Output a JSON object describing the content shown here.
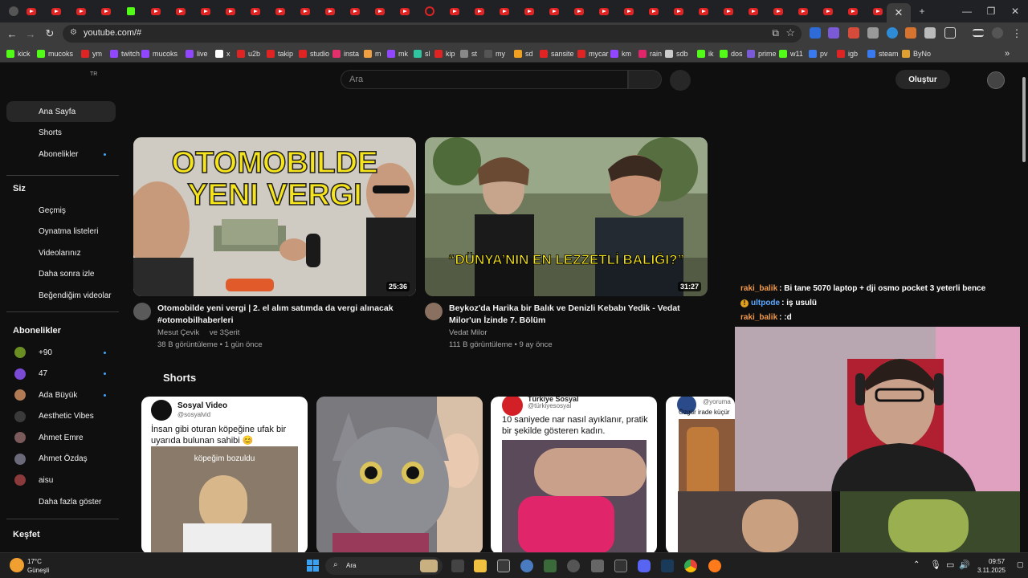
{
  "browser": {
    "active_tab_close": "✕",
    "new_tab": "+",
    "url": "youtube.com/#",
    "bookmarks": [
      "kick",
      "mucoks",
      "ym",
      "twitch",
      "mucoks",
      "live",
      "x",
      "u2b",
      "takip",
      "studio",
      "insta",
      "m",
      "mk",
      "sl",
      "kip",
      "st",
      "my",
      "sd",
      "sansite",
      "mycar",
      "km",
      "rain",
      "sdb",
      "ik",
      "dos",
      "prime",
      "w11",
      "pv",
      "igb",
      "steam",
      "ByNo"
    ]
  },
  "youtube": {
    "region_badge": "TR",
    "search_placeholder": "Ara",
    "create_label": "Oluştur",
    "sidebar": {
      "main": [
        {
          "label": "Ana Sayfa",
          "active": true
        },
        {
          "label": "Shorts"
        },
        {
          "label": "Abonelikler",
          "dot": true
        }
      ],
      "you_heading": "Siz",
      "you": [
        {
          "label": "Geçmiş"
        },
        {
          "label": "Oynatma listeleri"
        },
        {
          "label": "Videolarınız"
        },
        {
          "label": "Daha sonra izle"
        },
        {
          "label": "Beğendiğim videolar"
        }
      ],
      "subs_heading": "Abonelikler",
      "subs": [
        {
          "label": "+90",
          "dot": true,
          "color": "#6b8e23"
        },
        {
          "label": "47",
          "dot": true,
          "color": "#7b4bd6"
        },
        {
          "label": "Ada Büyük",
          "dot": true,
          "color": "#b07a54"
        },
        {
          "label": "Aesthetic Vibes",
          "color": "#3a3a3a"
        },
        {
          "label": "Ahmet Emre",
          "color": "#7a5a5a"
        },
        {
          "label": "Ahmet Özdaş",
          "color": "#6a6a7a"
        },
        {
          "label": "aisu",
          "color": "#8a3a3a"
        }
      ],
      "show_more": "Daha fazla göster",
      "explore_heading": "Keşfet"
    },
    "videos": [
      {
        "thumb_line1": "OTOMOBILDE",
        "thumb_line2": "YENI VERGI",
        "duration": "25:36",
        "title": "Otomobilde yeni vergi | 2. el alım satımda da vergi alınacak #otomobilhaberleri",
        "channel": "Mesut Çevik",
        "coauthor": "ve 3Şerit",
        "stats": "38 B görüntüleme • 1 gün önce"
      },
      {
        "thumb_caption": "“DÜNYA’NIN EN LEZZETLİ BALIĞI?”",
        "duration": "31:27",
        "title": "Beykoz'da Harika bir Balık ve Denizli Kebabı Yedik - Vedat Milor'un İzinde 7. Bölüm",
        "channel": "Vedat Milor",
        "stats": "111 B görüntüleme • 9 ay önce"
      }
    ],
    "shorts_heading": "Shorts",
    "shorts": [
      {
        "account": "Sosyal Video",
        "handle": "@sosyalvid",
        "text": "İnsan gibi oturan köpeğine ufak bir uyarıda bulunan sahibi 😊",
        "overlay": "köpeğim bozuldu"
      },
      {},
      {
        "account": "Türkiye Sosyal",
        "handle": "@türkiyesosyal",
        "text": "10 saniyede nar nasıl ayıklanır, pratik bir şekilde gösteren kadın."
      },
      {
        "handle": "@yoruma",
        "text": "Özgür irade küçür"
      }
    ]
  },
  "chat": [
    {
      "user": "raki_balik",
      "color": "#f29a4c",
      "message": ": Bi tane 5070 laptop + dji osmo pocket 3 yeterli bence"
    },
    {
      "user": "ultpode",
      "color": "#5aa7ff",
      "message": ": iş usulü",
      "badge": true
    },
    {
      "user": "raki_balik",
      "color": "#f29a4c",
      "message": ": :d"
    }
  ],
  "taskbar": {
    "weather_temp": "17°C",
    "weather_desc": "Güneşli",
    "search_label": "Ara",
    "time": "09:57",
    "date": "3.11.2025"
  }
}
